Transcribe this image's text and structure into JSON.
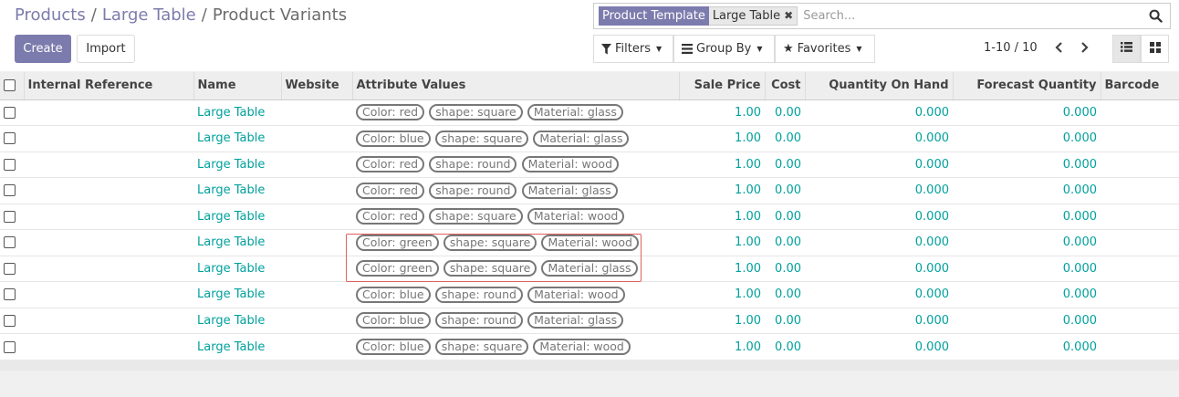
{
  "breadcrumb": [
    {
      "label": "Products",
      "link": true
    },
    {
      "label": "Large Table",
      "link": true
    },
    {
      "label": "Product Variants",
      "link": false
    }
  ],
  "buttons": {
    "create": "Create",
    "import": "Import"
  },
  "search": {
    "facet_category": "Product Template",
    "facet_value": "Large Table",
    "placeholder": "Search..."
  },
  "filters": {
    "filters": "Filters",
    "group_by": "Group By",
    "favorites": "Favorites"
  },
  "pager": {
    "value": "1-10 / 10"
  },
  "columns": {
    "internal_reference": "Internal Reference",
    "name": "Name",
    "website": "Website",
    "attribute_values": "Attribute Values",
    "sale_price": "Sale Price",
    "cost": "Cost",
    "qty_on_hand": "Quantity On Hand",
    "forecast_qty": "Forecast Quantity",
    "barcode": "Barcode"
  },
  "rows": [
    {
      "name": "Large Table",
      "attrs": [
        "Color: red",
        "shape: square",
        "Material: glass"
      ],
      "sale_price": "1.00",
      "cost": "0.00",
      "qty_on_hand": "0.000",
      "forecast_qty": "0.000"
    },
    {
      "name": "Large Table",
      "attrs": [
        "Color: blue",
        "shape: square",
        "Material: glass"
      ],
      "sale_price": "1.00",
      "cost": "0.00",
      "qty_on_hand": "0.000",
      "forecast_qty": "0.000"
    },
    {
      "name": "Large Table",
      "attrs": [
        "Color: red",
        "shape: round",
        "Material: wood"
      ],
      "sale_price": "1.00",
      "cost": "0.00",
      "qty_on_hand": "0.000",
      "forecast_qty": "0.000"
    },
    {
      "name": "Large Table",
      "attrs": [
        "Color: red",
        "shape: round",
        "Material: glass"
      ],
      "sale_price": "1.00",
      "cost": "0.00",
      "qty_on_hand": "0.000",
      "forecast_qty": "0.000"
    },
    {
      "name": "Large Table",
      "attrs": [
        "Color: red",
        "shape: square",
        "Material: wood"
      ],
      "sale_price": "1.00",
      "cost": "0.00",
      "qty_on_hand": "0.000",
      "forecast_qty": "0.000"
    },
    {
      "name": "Large Table",
      "attrs": [
        "Color: green",
        "shape: square",
        "Material: wood"
      ],
      "sale_price": "1.00",
      "cost": "0.00",
      "qty_on_hand": "0.000",
      "forecast_qty": "0.000"
    },
    {
      "name": "Large Table",
      "attrs": [
        "Color: green",
        "shape: square",
        "Material: glass"
      ],
      "sale_price": "1.00",
      "cost": "0.00",
      "qty_on_hand": "0.000",
      "forecast_qty": "0.000"
    },
    {
      "name": "Large Table",
      "attrs": [
        "Color: blue",
        "shape: round",
        "Material: wood"
      ],
      "sale_price": "1.00",
      "cost": "0.00",
      "qty_on_hand": "0.000",
      "forecast_qty": "0.000"
    },
    {
      "name": "Large Table",
      "attrs": [
        "Color: blue",
        "shape: round",
        "Material: glass"
      ],
      "sale_price": "1.00",
      "cost": "0.00",
      "qty_on_hand": "0.000",
      "forecast_qty": "0.000"
    },
    {
      "name": "Large Table",
      "attrs": [
        "Color: blue",
        "shape: square",
        "Material: wood"
      ],
      "sale_price": "1.00",
      "cost": "0.00",
      "qty_on_hand": "0.000",
      "forecast_qty": "0.000"
    }
  ],
  "colors": {
    "brand": "#7c7bad",
    "link": "#00a09d",
    "highlight": "#e06060"
  }
}
